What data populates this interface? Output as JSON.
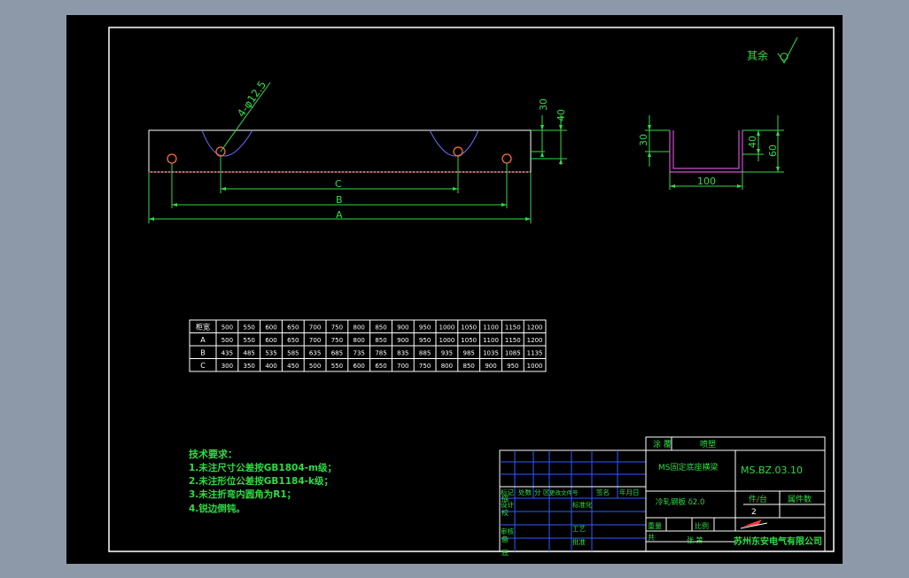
{
  "colors": {
    "frame_bg": "#8d99a8",
    "sheet_bg": "#000000",
    "line_white": "#ffffff",
    "text_green": "#2fdc45",
    "dim_green": "#2fdc45",
    "accent_magenta": "#d04fd0",
    "accent_red": "#ff3b3b",
    "table_blue": "#2f5bff"
  },
  "surface_note": "其余",
  "front_view": {
    "hole_label": "4-φ12.5",
    "dim_c": "C",
    "dim_b": "B",
    "dim_a": "A",
    "dim_30": "30",
    "dim_40": "40"
  },
  "side_view": {
    "dim_30": "30",
    "dim_40": "40",
    "dim_60": "60",
    "dim_100": "100"
  },
  "size_table": {
    "rows": [
      {
        "label": "柜宽",
        "values": [
          "500",
          "550",
          "600",
          "650",
          "700",
          "750",
          "800",
          "850",
          "900",
          "950",
          "1000",
          "1050",
          "1100",
          "1150",
          "1200"
        ]
      },
      {
        "label": "A",
        "values": [
          "500",
          "550",
          "600",
          "650",
          "700",
          "750",
          "800",
          "850",
          "900",
          "950",
          "1000",
          "1050",
          "1100",
          "1150",
          "1200"
        ]
      },
      {
        "label": "B",
        "values": [
          "435",
          "485",
          "535",
          "585",
          "635",
          "685",
          "735",
          "785",
          "835",
          "885",
          "935",
          "985",
          "1035",
          "1085",
          "1135"
        ]
      },
      {
        "label": "C",
        "values": [
          "300",
          "350",
          "400",
          "450",
          "500",
          "550",
          "600",
          "650",
          "700",
          "750",
          "800",
          "850",
          "900",
          "950",
          "1000"
        ]
      }
    ]
  },
  "tech_requirements": {
    "title": "技术要求：",
    "items": [
      "1.未注尺寸公差按GB1804-m级；",
      "2.未注形位公差按GB1184-k级；",
      "3.未注折弯内圆角为R1；",
      "4.锐边倒钝。"
    ]
  },
  "title_block": {
    "coating_label": "涂   覆",
    "coating_value": "喷塑",
    "part_name": "MS固定底座横梁",
    "drawing_no": "MS.BZ.03.10",
    "material": "冷轧钢板 δ2.0",
    "qty_label": "件/台",
    "qty_value": "2",
    "unit_label": "属件数",
    "weight_label": "重量",
    "scale_label": "比例",
    "sheets_label": "共",
    "sheet_label": "张 第",
    "company": "苏州东安电气有限公司",
    "revision_headers": [
      "标记",
      "处数",
      "分 区",
      "更改文件号",
      "签名",
      "年月日"
    ],
    "role_labels": [
      "设计",
      "标准化",
      "审核",
      "工艺",
      "批准"
    ],
    "left_marks": [
      "描",
      "校",
      "备",
      "底"
    ]
  }
}
